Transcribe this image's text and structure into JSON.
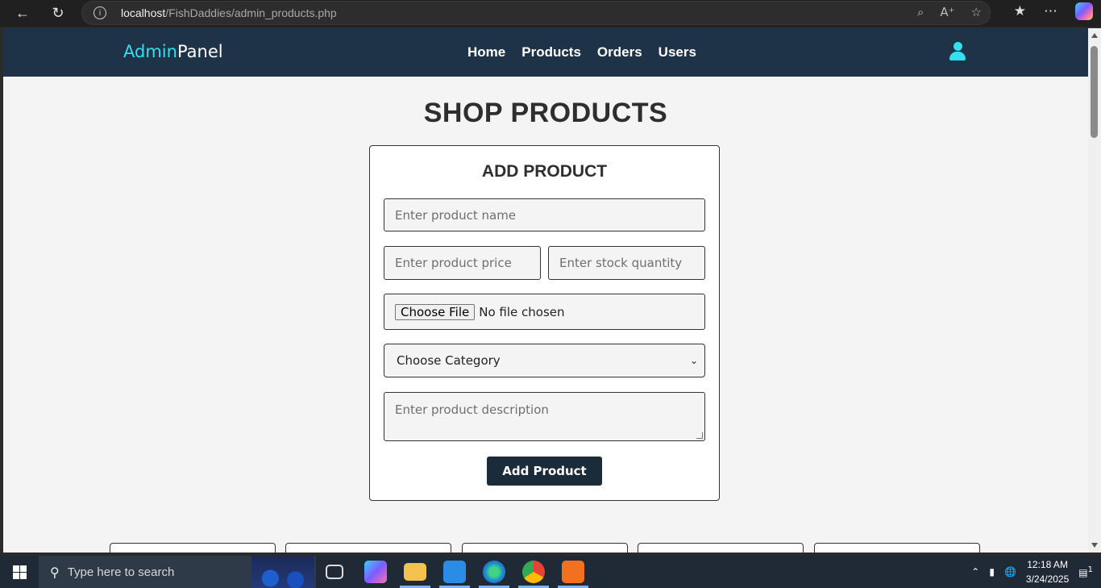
{
  "browser": {
    "url_host": "localhost",
    "url_path": "/FishDaddies/admin_products.php"
  },
  "header": {
    "logo_accent": "Admin",
    "logo_rest": "Panel",
    "menu": [
      "Home",
      "Products",
      "Orders",
      "Users"
    ]
  },
  "page": {
    "title": "SHOP PRODUCTS"
  },
  "form": {
    "title": "ADD PRODUCT",
    "name_placeholder": "Enter product name",
    "price_placeholder": "Enter product price",
    "stock_placeholder": "Enter stock quantity",
    "file_button": "Choose File",
    "file_status": "No file chosen",
    "category_selected": "Choose Category",
    "description_placeholder": "Enter product description",
    "submit_label": "Add Product"
  },
  "taskbar": {
    "search_placeholder": "Type here to search",
    "time": "12:18 AM",
    "date": "3/24/2025",
    "notification_count": "1"
  },
  "colors": {
    "header_bg": "#1e3347",
    "accent": "#33e0f0",
    "button_bg": "#1a2b3a",
    "page_bg": "#f4f4f4"
  }
}
